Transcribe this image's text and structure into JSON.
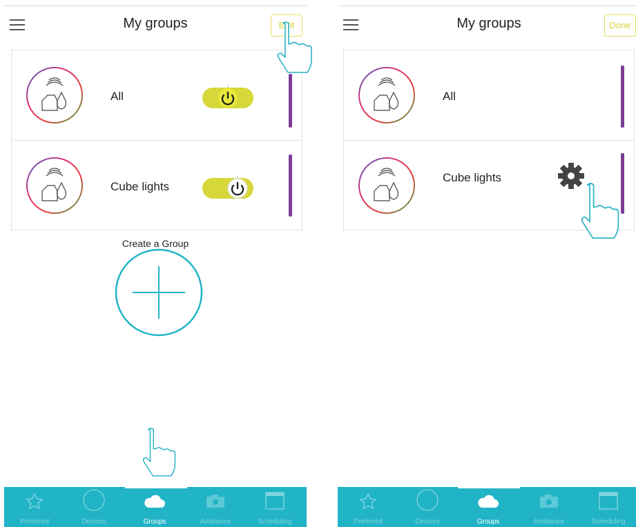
{
  "screens": [
    {
      "title": "My groups",
      "header_button": "Edit",
      "groups": [
        {
          "name": "All",
          "power": "on"
        },
        {
          "name": "Cube lights",
          "power": "off"
        }
      ],
      "create_label": "Create a Group"
    },
    {
      "title": "My groups",
      "header_button": "Done",
      "groups": [
        {
          "name": "All"
        },
        {
          "name": "Cube lights"
        }
      ]
    }
  ],
  "tabs": [
    {
      "label": "Preferred",
      "icon": "star-icon"
    },
    {
      "label": "Devices",
      "icon": "circle-icon"
    },
    {
      "label": "Groups",
      "icon": "cloud-icon",
      "active": true
    },
    {
      "label": "Ambiance",
      "icon": "camera-icon"
    },
    {
      "label": "Scheduling",
      "icon": "calendar-icon"
    }
  ],
  "colors": {
    "accent_teal": "#21b4c6",
    "toggle_yellow": "#d6d83a",
    "purple_bar": "#7a3e97",
    "edit_yellow": "#d9d23a"
  }
}
